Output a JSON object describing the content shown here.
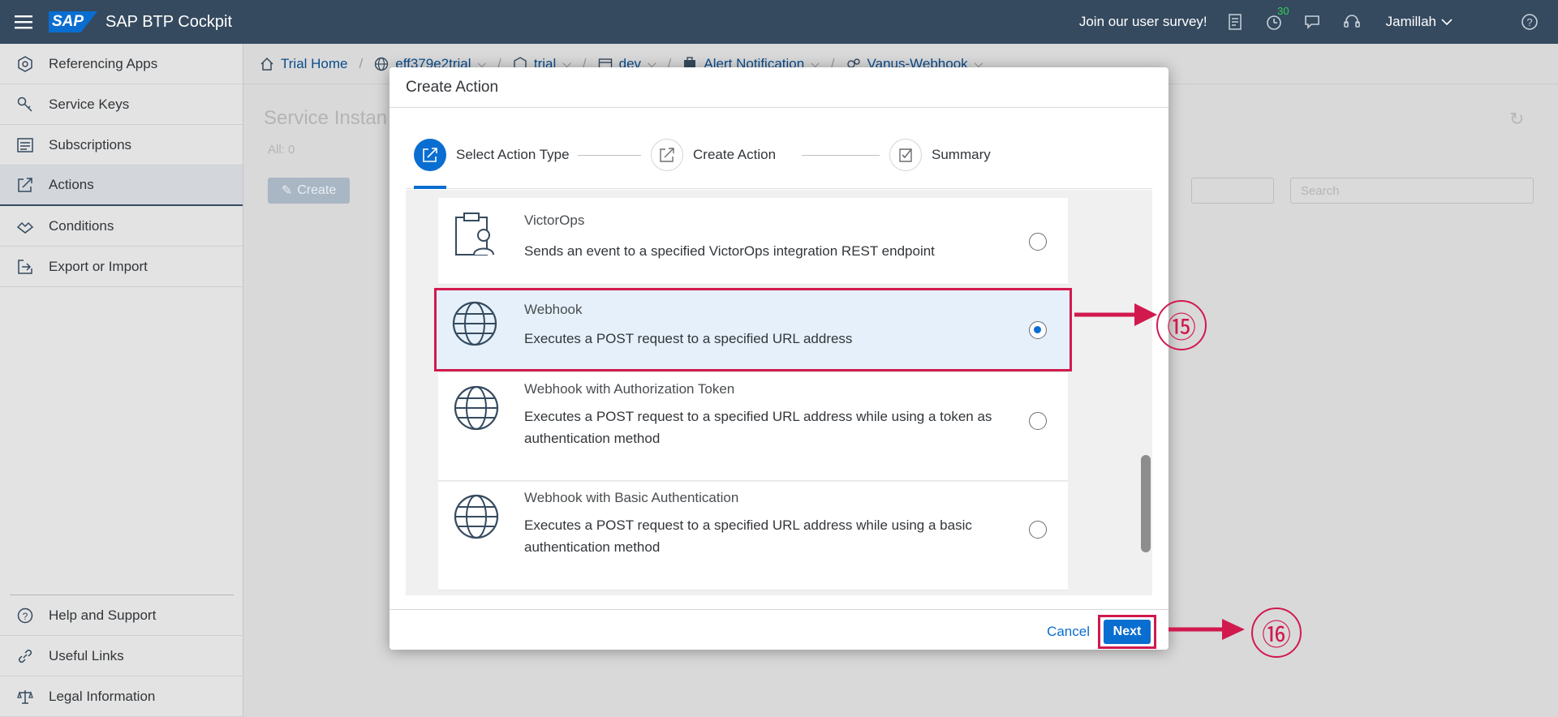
{
  "shell": {
    "title": "SAP BTP Cockpit",
    "logo": "SAP",
    "survey": "Join our user survey!",
    "notification_count": "30",
    "user": "Jamillah"
  },
  "sidebar": {
    "items": [
      {
        "label": "Referencing Apps",
        "icon": "referencing-apps-icon"
      },
      {
        "label": "Service Keys",
        "icon": "key-icon"
      },
      {
        "label": "Subscriptions",
        "icon": "subscriptions-icon"
      },
      {
        "label": "Actions",
        "icon": "actions-icon",
        "active": true
      },
      {
        "label": "Conditions",
        "icon": "conditions-icon"
      },
      {
        "label": "Export or Import",
        "icon": "export-import-icon"
      }
    ],
    "bottom": [
      {
        "label": "Help and Support",
        "icon": "help-icon"
      },
      {
        "label": "Useful Links",
        "icon": "link-icon"
      },
      {
        "label": "Legal Information",
        "icon": "legal-icon"
      }
    ]
  },
  "breadcrumb": {
    "home": "Trial Home",
    "subaccount": "eff379e2trial",
    "space_org": "trial",
    "space": "dev",
    "service": "Alert Notification",
    "instance": "Vanus-Webhook"
  },
  "main": {
    "title": "Service Instan",
    "count": "All: 0",
    "create": "Create",
    "search_placeholder": "Search"
  },
  "dialog": {
    "title": "Create Action",
    "steps": [
      "Select Action Type",
      "Create Action",
      "Summary"
    ],
    "options": [
      {
        "title": "VictorOps",
        "desc": "Sends an event to a specified VictorOps integration REST endpoint",
        "selected": false
      },
      {
        "title": "Webhook",
        "desc": "Executes a POST request to a specified URL address",
        "selected": true
      },
      {
        "title": "Webhook with Authorization Token",
        "desc": "Executes a POST request to a specified URL address while using a token as authentication method",
        "selected": false
      },
      {
        "title": "Webhook with Basic Authentication",
        "desc": "Executes a POST request to a specified URL address while using a basic authentication method",
        "selected": false
      }
    ],
    "cancel": "Cancel",
    "next": "Next"
  },
  "annotations": {
    "step15": "⑮",
    "step16": "⑯",
    "accent": "#d1194e"
  }
}
